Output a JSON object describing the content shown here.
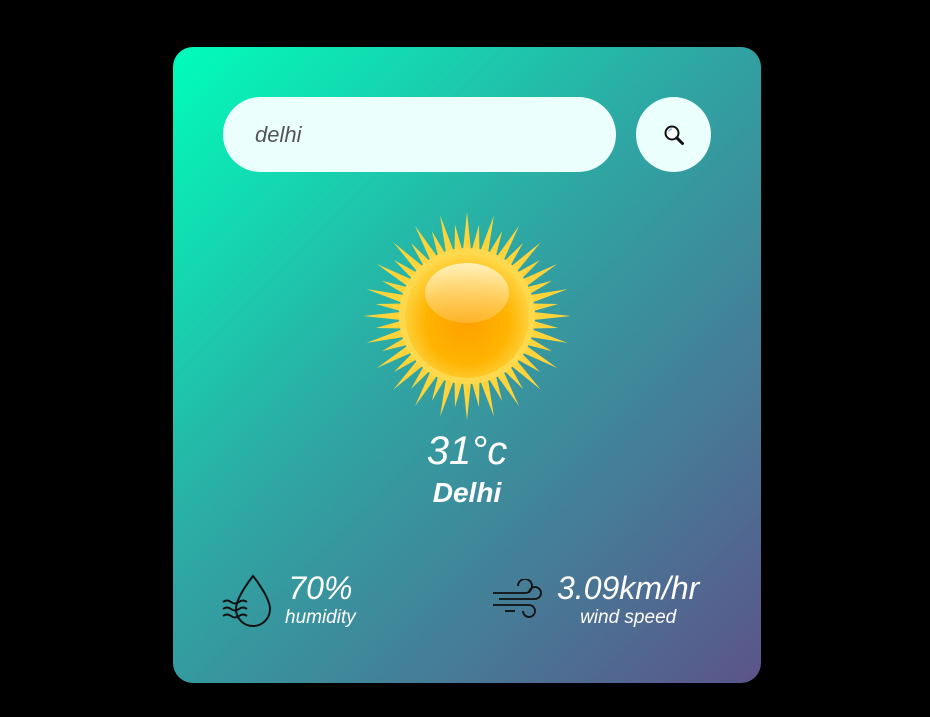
{
  "search": {
    "value": "delhi",
    "button_icon": "search-icon"
  },
  "weather": {
    "icon": "sun-icon",
    "temperature": "31°c",
    "city": "Delhi"
  },
  "details": {
    "humidity": {
      "icon": "humidity-icon",
      "value": "70%",
      "label": "humidity"
    },
    "wind": {
      "icon": "wind-icon",
      "value": "3.09km/hr",
      "label": "wind speed"
    }
  },
  "colors": {
    "background": "#000000",
    "card_gradient_start": "#00feba",
    "card_gradient_end": "#5b548a",
    "input_background": "#ebfffc",
    "text": "#ffffff"
  }
}
